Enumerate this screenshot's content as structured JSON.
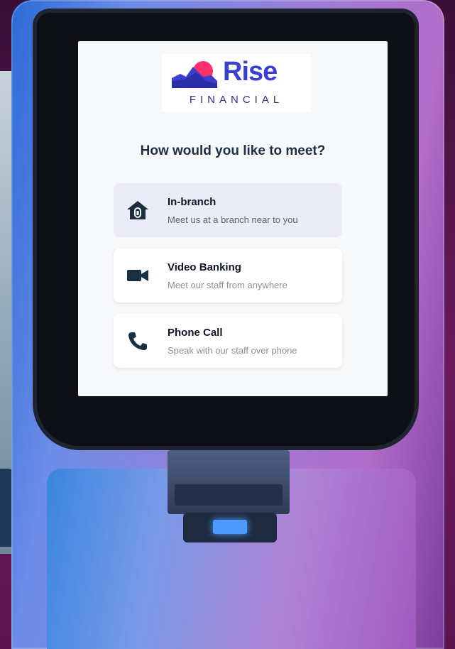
{
  "brand": {
    "name": "Rise",
    "subtitle": "FINANCIAL",
    "colors": {
      "primary": "#3b3fd0",
      "accent": "#ff2f6b"
    }
  },
  "screen": {
    "heading": "How would you like to meet?",
    "options": [
      {
        "title": "In-branch",
        "subtitle": "Meet us at a branch near to you",
        "icon": "branch-house-icon",
        "selected": true
      },
      {
        "title": "Video Banking",
        "subtitle": "Meet our staff from anywhere",
        "icon": "video-camera-icon",
        "selected": false
      },
      {
        "title": "Phone Call",
        "subtitle": "Speak with our staff over phone",
        "icon": "phone-icon",
        "selected": false
      }
    ]
  }
}
